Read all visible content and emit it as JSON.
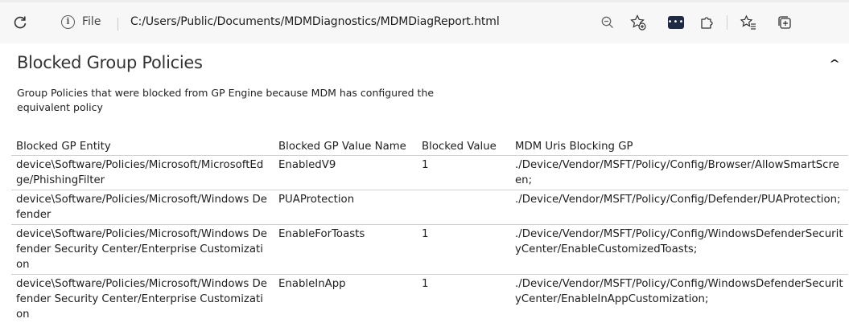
{
  "browser": {
    "file_label": "File",
    "url": "C:/Users/Public/Documents/MDMDiagnostics/MDMDiagReport.html"
  },
  "section": {
    "title": "Blocked Group Policies",
    "collapse_glyph": "^",
    "description": "Group Policies that were blocked from GP Engine because MDM has configured the equivalent policy"
  },
  "table": {
    "headers": [
      "Blocked GP Entity",
      "Blocked GP Value Name",
      "Blocked Value",
      "MDM Uris Blocking GP"
    ],
    "rows": [
      {
        "entity": "device\\Software/Policies/Microsoft/MicrosoftEdge/PhishingFilter",
        "value_name": "EnabledV9",
        "value": "1",
        "uri": "./Device/Vendor/MSFT/Policy/Config/Browser/AllowSmartScreen;"
      },
      {
        "entity": "device\\Software/Policies/Microsoft/Windows Defender",
        "value_name": "PUAProtection",
        "value": "",
        "uri": "./Device/Vendor/MSFT/Policy/Config/Defender/PUAProtection;"
      },
      {
        "entity": "device\\Software/Policies/Microsoft/Windows Defender Security Center/Enterprise Customization",
        "value_name": "EnableForToasts",
        "value": "1",
        "uri": "./Device/Vendor/MSFT/Policy/Config/WindowsDefenderSecurityCenter/EnableCustomizedToasts;"
      },
      {
        "entity": "device\\Software/Policies/Microsoft/Windows Defender Security Center/Enterprise Customization",
        "value_name": "EnableInApp",
        "value": "1",
        "uri": "./Device/Vendor/MSFT/Policy/Config/WindowsDefenderSecurityCenter/EnableInAppCustomization;"
      }
    ]
  }
}
